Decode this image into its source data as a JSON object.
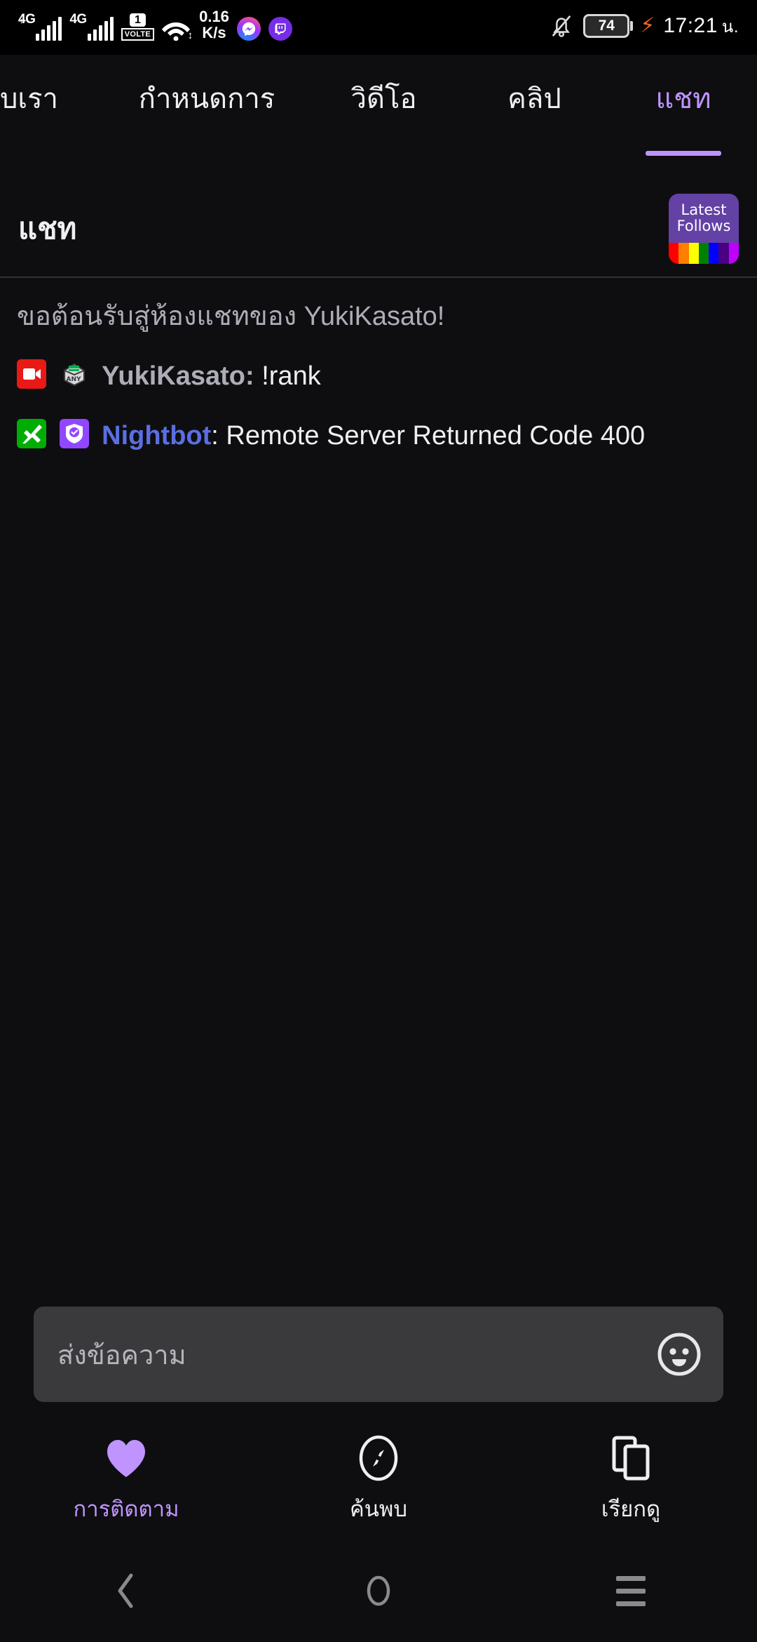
{
  "status_bar": {
    "network_type_1": "4G",
    "network_type_2": "4G",
    "sim_number": "1",
    "volte_label": "VOLTE",
    "net_speed_value": "0.16",
    "net_speed_unit": "K/s",
    "app_icons": [
      "messenger-icon",
      "twitch-icon"
    ],
    "mute_icon": "bell-muted-icon",
    "battery_level": "74",
    "charging_icon": "lightning-bolt-icon",
    "time": "17:21",
    "time_suffix": "น."
  },
  "top_tabs": {
    "items": [
      {
        "label": "บเรา",
        "active": false
      },
      {
        "label": "กำหนดการ",
        "active": false
      },
      {
        "label": "วิดีโอ",
        "active": false
      },
      {
        "label": "คลิป",
        "active": false
      },
      {
        "label": "แชท",
        "active": true
      }
    ],
    "active_color": "#bf94ff"
  },
  "chat_header": {
    "title": "แชท",
    "latest_follows_badge": {
      "line1": "Latest",
      "line2": "Follows",
      "bg_color": "#6441a5",
      "stripe_colors": [
        "#ff0000",
        "#ff7f00",
        "#ffff00",
        "#008000",
        "#0000ff",
        "#4b0082",
        "#bf00ff"
      ]
    }
  },
  "chat": {
    "welcome_message": "ขอต้อนรับสู่ห้องแชทของ YukiKasato!",
    "messages": [
      {
        "badges": [
          "broadcaster-badge",
          "any-subscriber-badge"
        ],
        "username": "YukiKasato",
        "username_color": "#adadb8",
        "separator": ": ",
        "text": "!rank"
      },
      {
        "badges": [
          "moderator-badge",
          "verified-badge"
        ],
        "username": "Nightbot",
        "username_color": "#5b6ee1",
        "separator": ": ",
        "text": "Remote Server Returned Code 400"
      }
    ]
  },
  "message_input": {
    "placeholder": "ส่งข้อความ",
    "value": "",
    "emoji_button": "smiley-face-icon"
  },
  "bottom_nav": {
    "items": [
      {
        "label": "การติดตาม",
        "icon": "heart-icon",
        "active": true
      },
      {
        "label": "ค้นพบ",
        "icon": "compass-icon",
        "active": false
      },
      {
        "label": "เรียกดู",
        "icon": "cards-icon",
        "active": false
      }
    ],
    "active_color": "#bf94ff"
  },
  "system_nav": {
    "back": "back-chevron-icon",
    "home": "home-circle-icon",
    "recents": "recents-menu-icon"
  }
}
